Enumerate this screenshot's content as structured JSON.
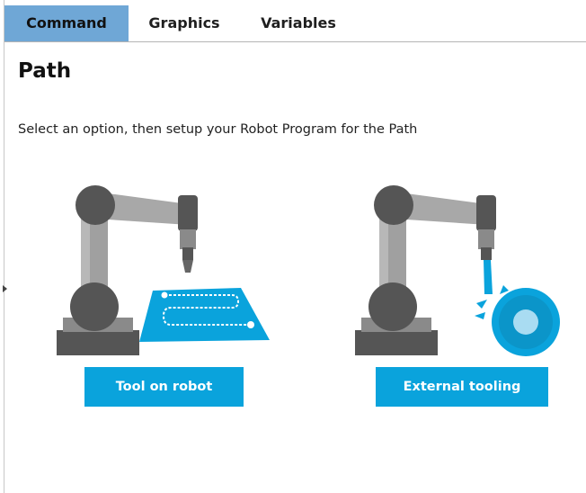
{
  "tabs": [
    {
      "label": "Command",
      "active": true
    },
    {
      "label": "Graphics",
      "active": false
    },
    {
      "label": "Variables",
      "active": false
    }
  ],
  "page": {
    "title": "Path",
    "instruction": "Select an option, then setup your Robot Program for the Path"
  },
  "options": [
    {
      "label": "Tool on robot",
      "icon": "robot-tool-on-robot-illustration"
    },
    {
      "label": "External tooling",
      "icon": "robot-external-tooling-illustration"
    }
  ],
  "colors": {
    "accent": "#0aa3dc",
    "tab_active": "#6fa7d6",
    "robot_dark": "#555555",
    "robot_mid": "#8a8a8a",
    "robot_light": "#b8b8b8"
  }
}
